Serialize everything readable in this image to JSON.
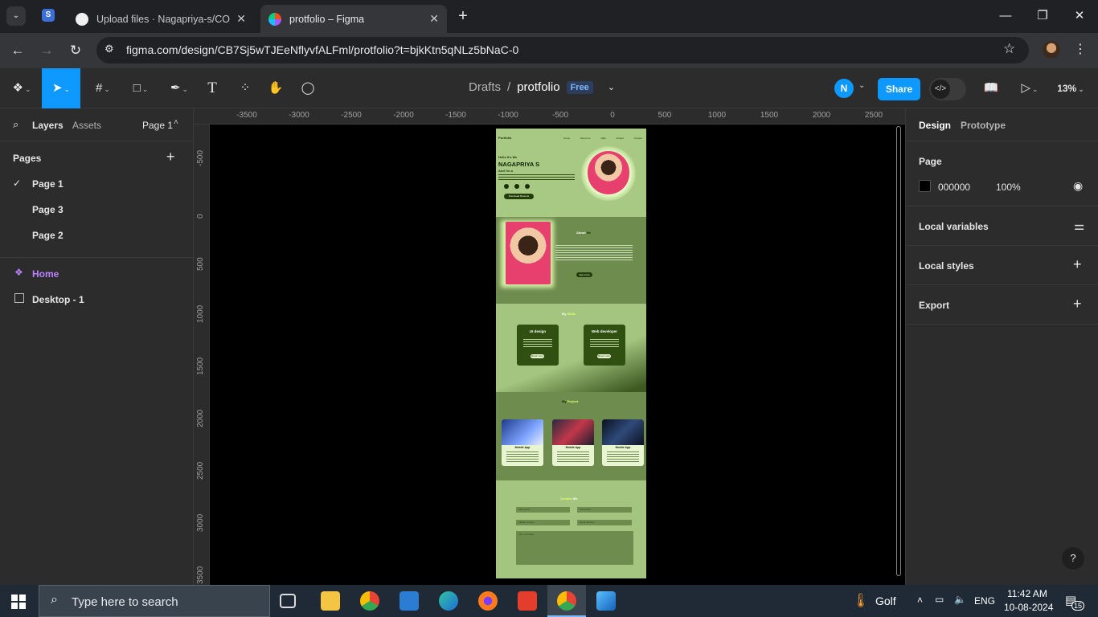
{
  "browser": {
    "tabs": [
      {
        "title": "Upload files · Nagapriya-s/COD",
        "active": false
      },
      {
        "title": "protfolio – Figma",
        "active": true
      }
    ],
    "new_tab": "+",
    "url": "figma.com/design/CB7Sj5wTJEeNflyvfALFml/protfolio?t=bjkKtn5qNLz5bNaC-0",
    "window": {
      "minimize": "—",
      "maximize": "❐",
      "close": "✕"
    }
  },
  "figma": {
    "breadcrumb": {
      "parent": "Drafts",
      "separator": "/",
      "file": "protfolio",
      "plan": "Free"
    },
    "user_initial": "N",
    "share_label": "Share",
    "zoom": "13%",
    "dev_mode_icon": "</>"
  },
  "left_panel": {
    "tabs": [
      "Layers",
      "Assets"
    ],
    "page_selector": "Page 1",
    "pages_header": "Pages",
    "pages": [
      "Page 1",
      "Page 3",
      "Page 2"
    ],
    "selected_page": "Page 1",
    "layers": [
      {
        "name": "Home",
        "type": "component",
        "color": "#b982ff"
      },
      {
        "name": "Desktop - 1",
        "type": "frame",
        "color": "#e6e6e6"
      }
    ]
  },
  "rulers": {
    "horizontal": [
      "-3500",
      "-3000",
      "-2500",
      "-2000",
      "-1500",
      "-1000",
      "-500",
      "0",
      "500",
      "1000",
      "1500",
      "2000",
      "2500"
    ],
    "vertical": [
      "-500",
      "0",
      "500",
      "1000",
      "1500",
      "2000",
      "2500",
      "3000",
      "3500"
    ]
  },
  "design_frame": {
    "logo": "Portfolio",
    "nav": [
      "Home",
      "About me",
      "skills",
      "Project",
      "Contact"
    ],
    "hero": {
      "greeting": "Hello It's Me",
      "name": "NAGAPRIYA S",
      "role": "And I'm a",
      "download": "Download Resume"
    },
    "about": {
      "title": "About",
      "title_accent": "Me",
      "button": "See more"
    },
    "skills": {
      "title_accent": "My",
      "title": "Skills",
      "cards": [
        {
          "title": "UI design",
          "button": "Read more"
        },
        {
          "title": "Web developer",
          "button": "Read more"
        }
      ]
    },
    "project": {
      "title_accent": "My",
      "title": "Project",
      "cards": [
        "Mobile App",
        "Mobile App",
        "Mobile App"
      ]
    },
    "contact": {
      "title": "Contact",
      "title_accent": "Me",
      "fields": [
        "First name",
        "Last name",
        "Mobile number",
        "email address",
        "Your message"
      ]
    },
    "colors": {
      "background": "#a3c57f",
      "dark": "#233d06",
      "mid": "#6f8c4f"
    }
  },
  "right_panel": {
    "tabs": [
      "Design",
      "Prototype"
    ],
    "page_section": "Page",
    "page_color": "000000",
    "page_opacity": "100%",
    "sections": [
      "Local variables",
      "Local styles",
      "Export"
    ]
  },
  "help_label": "?",
  "taskbar": {
    "search_placeholder": "Type here to search",
    "weather": "Golf",
    "language": "ENG",
    "time": "11:42 AM",
    "date": "10-08-2024",
    "notifications": "15"
  }
}
